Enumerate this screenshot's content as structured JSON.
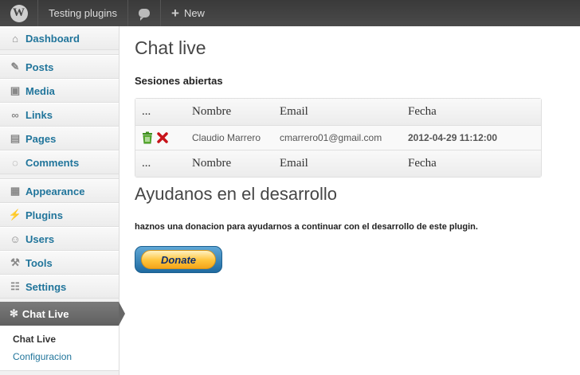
{
  "adminbar": {
    "site_name": "Testing plugins",
    "new_label": "New"
  },
  "sidebar": {
    "items": [
      {
        "label": "Dashboard",
        "icon": "home-icon"
      },
      {
        "label": "Posts",
        "icon": "pin-icon"
      },
      {
        "label": "Media",
        "icon": "camera-icon"
      },
      {
        "label": "Links",
        "icon": "link-icon"
      },
      {
        "label": "Pages",
        "icon": "page-icon"
      },
      {
        "label": "Comments",
        "icon": "comment-icon"
      },
      {
        "label": "Appearance",
        "icon": "appearance-icon"
      },
      {
        "label": "Plugins",
        "icon": "plug-icon"
      },
      {
        "label": "Users",
        "icon": "users-icon"
      },
      {
        "label": "Tools",
        "icon": "tools-icon"
      },
      {
        "label": "Settings",
        "icon": "settings-icon"
      }
    ],
    "active": {
      "label": "Chat Live",
      "icon": "gear-icon"
    },
    "submenu": [
      "Chat Live",
      "Configuracion"
    ]
  },
  "main": {
    "title": "Chat live",
    "section_title": "Sesiones abiertas",
    "table": {
      "headers": [
        "...",
        "Nombre",
        "Email",
        "Fecha"
      ],
      "rows": [
        {
          "name": "Claudio Marrero",
          "email": "cmarrero01@gmail.com",
          "date": "2012-04-29 11:12:00"
        }
      ],
      "footers": [
        "...",
        "Nombre",
        "Email",
        "Fecha"
      ]
    },
    "donate_heading": "Ayudanos en el desarrollo",
    "donate_text": "haznos una donacion para ayudarnos a continuar con el desarrollo de este plugin.",
    "donate_button": "Donate"
  },
  "colors": {
    "link": "#21759b",
    "adminbar": "#464646",
    "active_menu": "#6d6d6d"
  }
}
